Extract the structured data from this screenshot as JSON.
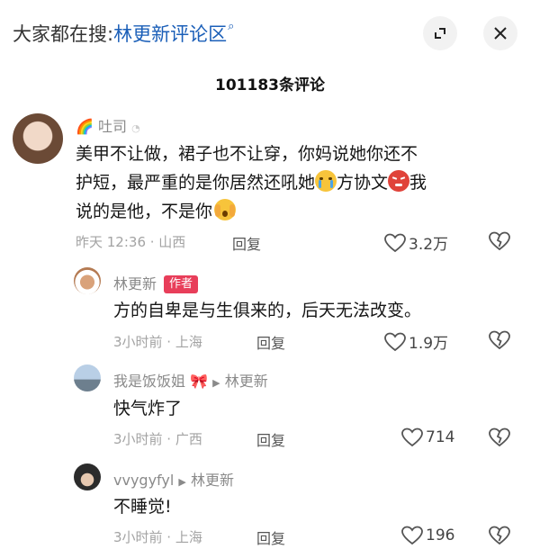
{
  "search": {
    "prefix": "大家都在搜:",
    "query": "林更新评论区"
  },
  "header": {
    "count_title": "101183条评论"
  },
  "comments": [
    {
      "username": "吐司",
      "text_line1": "美甲不让做，裙子也不让穿，你妈说她你还不",
      "text_line2a": "护短，最严重的是你居然还吼她",
      "text_line2b": "方协文",
      "text_line2c": "我",
      "text_line3": "说的是他，不是你",
      "time_loc": "昨天 12:36 · 山西",
      "reply_label": "回复",
      "likes": "3.2万"
    },
    {
      "username": "林更新",
      "author_tag": "作者",
      "text": "方的自卑是与生俱来的，后天无法改变。",
      "time_loc": "3小时前 · 上海",
      "reply_label": "回复",
      "likes": "1.9万"
    },
    {
      "username": "我是饭饭姐",
      "reply_to": "林更新",
      "text": "快气炸了",
      "time_loc": "3小时前 · 广西",
      "reply_label": "回复",
      "likes": "714"
    },
    {
      "username": "vvygyfyl",
      "reply_to": "林更新",
      "text": "不睡觉!",
      "time_loc": "3小时前 · 上海",
      "reply_label": "回复",
      "likes": "196"
    }
  ],
  "colors": {
    "link_blue": "#1b5fb8",
    "author_red": "#e83e5a",
    "meta_grey": "#a3a3a3"
  }
}
